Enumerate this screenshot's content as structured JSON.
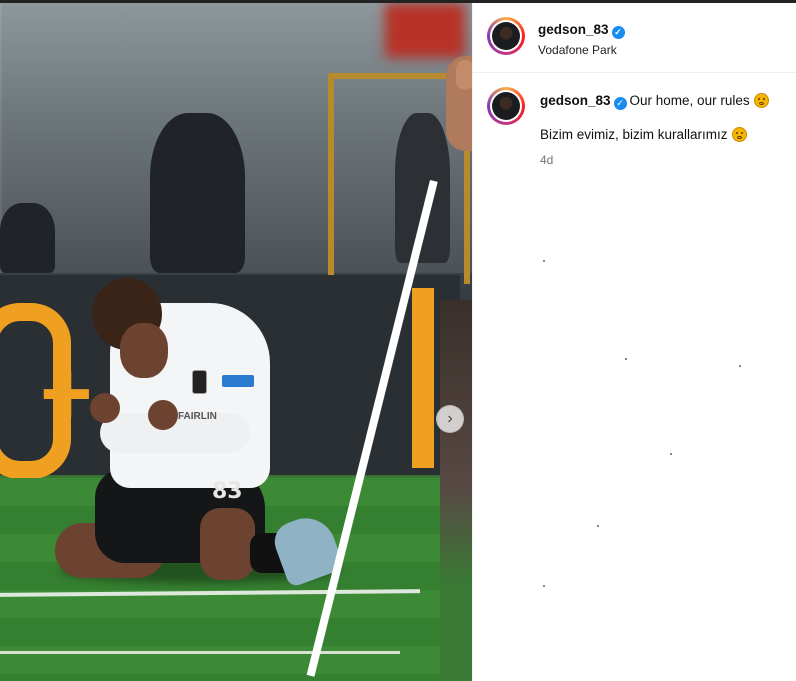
{
  "post": {
    "username": "gedson_83",
    "location": "Vodafone Park",
    "caption": "Our home, our rules",
    "translation": "Bizim evimiz, bizim kurallarımız",
    "age": "4d",
    "photo_jersey_number": "83",
    "photo_sponsor": "FAIRLIN"
  },
  "icons": {
    "verified": "verified-badge-icon",
    "next": "chevron-right-icon",
    "emoji": "pleading-face-emoji"
  },
  "colors": {
    "verified_blue": "#1a8cf0",
    "meta_gray": "#737373"
  }
}
